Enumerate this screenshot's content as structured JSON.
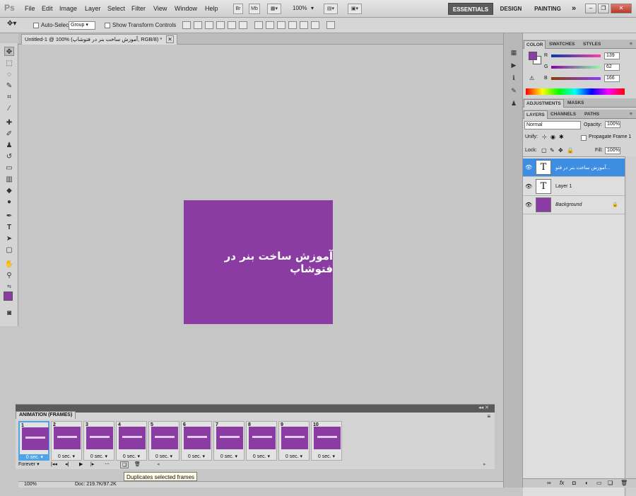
{
  "app": {
    "logo": "Ps"
  },
  "menu": [
    "File",
    "Edit",
    "Image",
    "Layer",
    "Select",
    "Filter",
    "View",
    "Window",
    "Help"
  ],
  "menubar_tools": {
    "bridge": "Br",
    "minibridge": "Mb",
    "zoom": "100%"
  },
  "workspaces": {
    "active": "ESSENTIALS",
    "design": "DESIGN",
    "painting": "PAINTING",
    "more": "»"
  },
  "options_bar": {
    "auto_select_label": "Auto-Select:",
    "auto_select_value": "Group",
    "show_transform_label": "Show Transform Controls"
  },
  "document": {
    "tab_label": "Untitled-1 @ 100% (آموزش ساخت بنر در فتوشاپ, RGB/8) *",
    "canvas_text": "آموزش ساخت بنر در فتوشاپ",
    "canvas_color": "#8a3ca3"
  },
  "animation": {
    "panel_title": "ANIMATION (FRAMES)",
    "frames": [
      {
        "num": "1",
        "dur": "0 sec."
      },
      {
        "num": "2",
        "dur": "0 sec."
      },
      {
        "num": "3",
        "dur": "0 sec."
      },
      {
        "num": "4",
        "dur": "0 sec."
      },
      {
        "num": "5",
        "dur": "0 sec."
      },
      {
        "num": "6",
        "dur": "0 sec."
      },
      {
        "num": "7",
        "dur": "0 sec."
      },
      {
        "num": "8",
        "dur": "0 sec."
      },
      {
        "num": "9",
        "dur": "0 sec."
      },
      {
        "num": "10",
        "dur": "0 sec."
      }
    ],
    "loop": "Forever",
    "tooltip": "Duplicates selected frames"
  },
  "status": {
    "zoom": "100%",
    "doc": "Doc: 219.7K/97.2K"
  },
  "color_panel": {
    "tabs": [
      "COLOR",
      "SWATCHES",
      "STYLES"
    ],
    "r_label": "R",
    "g_label": "G",
    "b_label": "B",
    "r": "139",
    "g": "62",
    "b": "166",
    "fg": "#8b3ea6"
  },
  "adjustments_panel": {
    "tabs": [
      "ADJUSTMENTS",
      "MASKS"
    ]
  },
  "layers_panel": {
    "tabs": [
      "LAYERS",
      "CHANNELS",
      "PATHS"
    ],
    "blend_mode": "Normal",
    "opacity_label": "Opacity:",
    "opacity": "100%",
    "unify_label": "Unify:",
    "propagate_label": "Propagate Frame 1",
    "lock_label": "Lock:",
    "fill_label": "Fill:",
    "fill": "100%",
    "layers": [
      {
        "name": "آموزش ساخت بنر در فتو...",
        "type": "T",
        "selected": true
      },
      {
        "name": "Layer 1",
        "type": "T",
        "selected": false
      },
      {
        "name": "Background",
        "type": "bg",
        "selected": false
      }
    ]
  }
}
